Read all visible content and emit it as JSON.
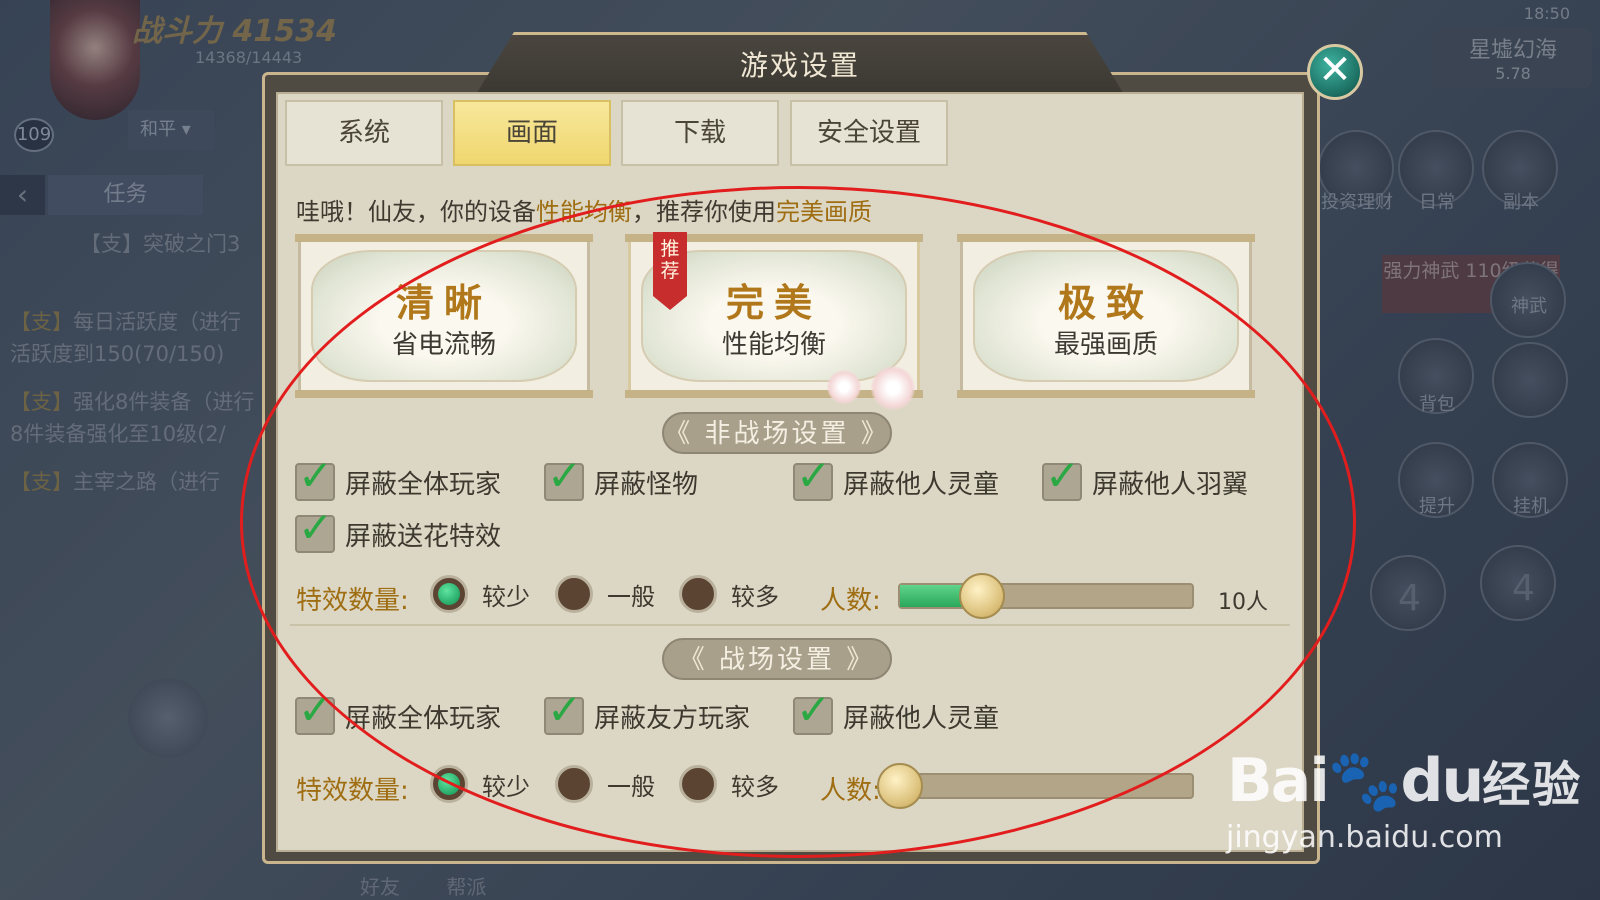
{
  "hud": {
    "power": "战斗力 41534",
    "hp": "14368/14443",
    "level": "109",
    "mode": "和平",
    "task_tab": "任务",
    "quests": [
      {
        "tag": "【支】",
        "text": "每日活跃度（进行",
        "sub": "活跃度到150(70/150)"
      },
      {
        "tag": "【支】",
        "text": "强化8件装备（进行",
        "sub": "8件装备强化至10级(2/"
      },
      {
        "tag": "【支】",
        "text": "主宰之路（进行",
        "sub": ""
      }
    ],
    "breakthrough": "【支】突破之门3",
    "clock": "18:50",
    "server_name": "星墟幻海",
    "server_value": "5.78",
    "right_labels": [
      "投资理财",
      "日常",
      "副本",
      "神武",
      "背包",
      "提升",
      "挂机"
    ],
    "promo": "强力神武 110级获得",
    "bottom_tabs": [
      "好友",
      "帮派"
    ],
    "skill_nums": [
      "4",
      "4"
    ]
  },
  "dialog": {
    "title": "游戏设置",
    "close_icon": "close-icon",
    "tabs": [
      {
        "label": "系统",
        "active": false
      },
      {
        "label": "画面",
        "active": true
      },
      {
        "label": "下载",
        "active": false
      },
      {
        "label": "安全设置",
        "active": false
      }
    ],
    "hint_prefix": "哇哦！仙友，你的设备",
    "hint_perf": "性能均衡",
    "hint_middle": "，推荐你使用",
    "hint_quality": "完美画质",
    "presets": [
      {
        "name": "清晰",
        "desc": "省电流畅",
        "recommended": false
      },
      {
        "name": "完美",
        "desc": "性能均衡",
        "recommended": true,
        "badge": "推荐"
      },
      {
        "name": "极致",
        "desc": "最强画质",
        "recommended": false
      }
    ],
    "non_battle": {
      "header": "非战场设置",
      "checkboxes": [
        {
          "label": "屏蔽全体玩家",
          "checked": true
        },
        {
          "label": "屏蔽怪物",
          "checked": true
        },
        {
          "label": "屏蔽他人灵童",
          "checked": true
        },
        {
          "label": "屏蔽他人羽翼",
          "checked": true
        },
        {
          "label": "屏蔽送花特效",
          "checked": true
        }
      ],
      "fx_label": "特效数量:",
      "fx_options": [
        "较少",
        "一般",
        "较多"
      ],
      "fx_selected": "较少",
      "people_label": "人数:",
      "people_value": "10人",
      "people_fraction": 0.28
    },
    "battle": {
      "header": "战场设置",
      "checkboxes": [
        {
          "label": "屏蔽全体玩家",
          "checked": true
        },
        {
          "label": "屏蔽友方玩家",
          "checked": true
        },
        {
          "label": "屏蔽他人灵童",
          "checked": true
        }
      ],
      "fx_label": "特效数量:",
      "fx_options": [
        "较少",
        "一般",
        "较多"
      ],
      "fx_selected": "较少",
      "people_label": "人数:",
      "people_fraction": 0.0
    }
  },
  "watermark": {
    "logo": "Bai",
    "logo_du": "du",
    "logo_jy": "经验",
    "url": "jingyan.baidu.com"
  },
  "colors": {
    "accent_gold": "#9f6d12",
    "check_green": "#2aa843",
    "annotation_red": "#e21d1d",
    "close_teal": "#1b6d61"
  }
}
